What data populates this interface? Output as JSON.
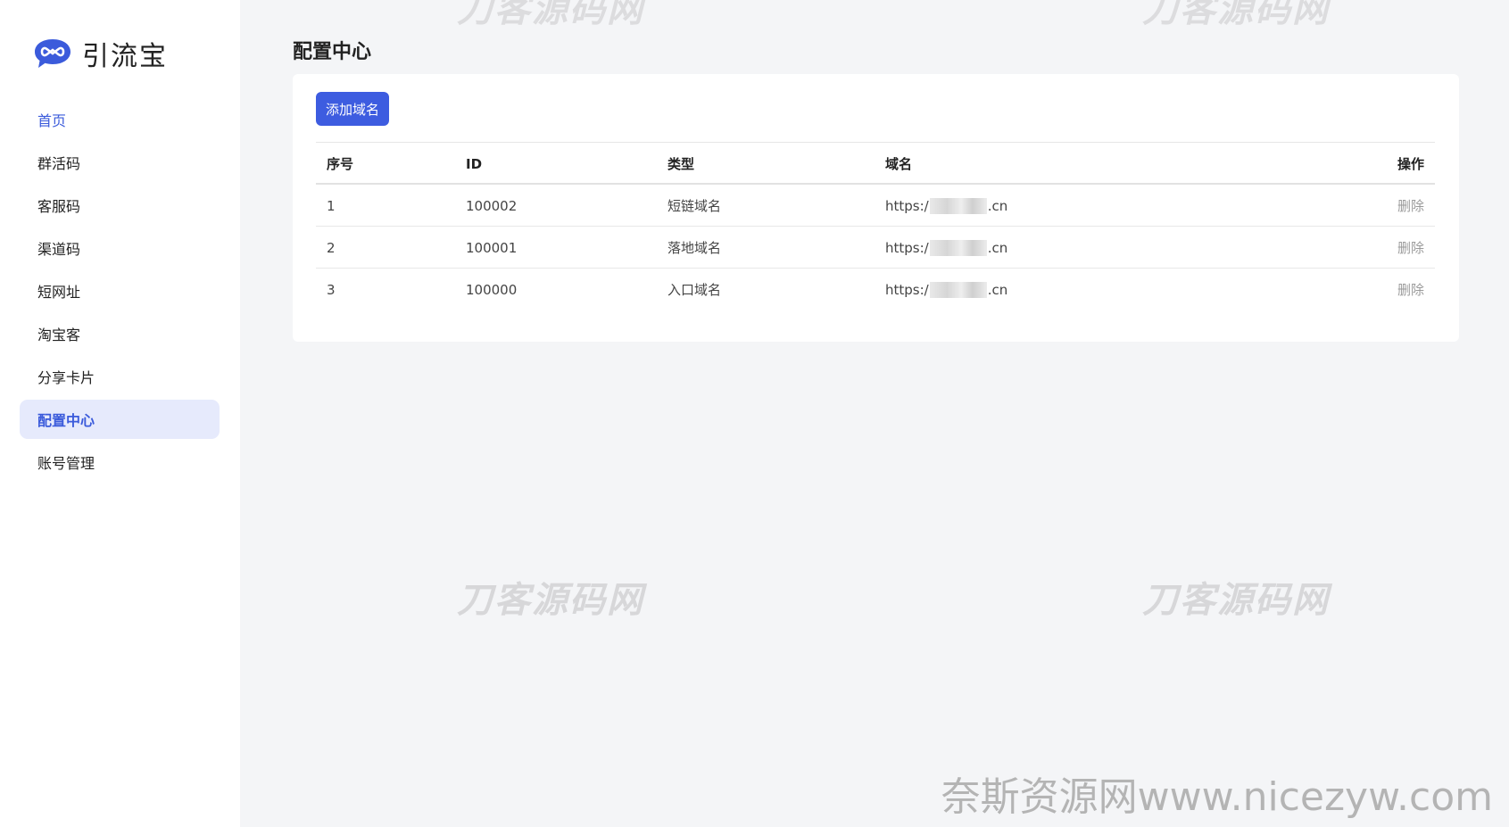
{
  "brand": {
    "name": "引流宝",
    "logo_icon": "chat-bubble-infinity-icon",
    "color": "#3b5bdb"
  },
  "sidebar": {
    "items": [
      {
        "label": "首页"
      },
      {
        "label": "群活码"
      },
      {
        "label": "客服码"
      },
      {
        "label": "渠道码"
      },
      {
        "label": "短网址"
      },
      {
        "label": "淘宝客"
      },
      {
        "label": "分享卡片"
      },
      {
        "label": "配置中心"
      },
      {
        "label": "账号管理"
      }
    ],
    "active_index": 7
  },
  "page": {
    "title": "配置中心",
    "add_button": "添加域名"
  },
  "table": {
    "headers": [
      "序号",
      "ID",
      "类型",
      "域名",
      "操作"
    ],
    "rows": [
      {
        "idx": "1",
        "id": "100002",
        "type": "短链域名",
        "domain_prefix": "https:/",
        "domain_suffix": ".cn",
        "action": "删除"
      },
      {
        "idx": "2",
        "id": "100001",
        "type": "落地域名",
        "domain_prefix": "https:/",
        "domain_suffix": ".cn",
        "action": "删除"
      },
      {
        "idx": "3",
        "id": "100000",
        "type": "入口域名",
        "domain_prefix": "https:/",
        "domain_suffix": ".cn",
        "action": "删除"
      }
    ]
  },
  "watermarks": {
    "center": "刀客源码网",
    "site": "奈斯资源网www.nicezyw.com"
  },
  "colors": {
    "accent": "#3d5ce0",
    "active_bg": "#e6eafc",
    "page_bg": "#f4f5f7"
  }
}
